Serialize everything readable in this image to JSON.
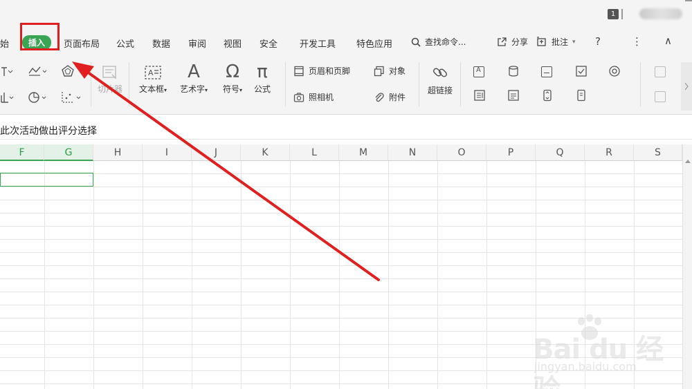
{
  "titlebar": {
    "badge": "1"
  },
  "menu": {
    "tabs": [
      {
        "label": "始",
        "active": false
      },
      {
        "label": "插入",
        "active": true
      },
      {
        "label": "页面布局",
        "active": false
      },
      {
        "label": "公式",
        "active": false
      },
      {
        "label": "数据",
        "active": false
      },
      {
        "label": "审阅",
        "active": false
      },
      {
        "label": "视图",
        "active": false
      },
      {
        "label": "安全",
        "active": false
      },
      {
        "label": "开发工具",
        "active": false
      },
      {
        "label": "特色应用",
        "active": false
      }
    ],
    "search_label": "查找命令...",
    "share_label": "分享",
    "comment_label": "批注",
    "help_glyph": "?",
    "more_glyph": "⋮",
    "collapse_glyph": "∧"
  },
  "ribbon": {
    "slicer_label": "切片器",
    "textbox_label": "文本框",
    "wordart_label": "艺术字",
    "symbol_label": "符号",
    "formula_label": "公式",
    "header_footer_label": "页眉和页脚",
    "camera_label": "照相机",
    "object_label": "对象",
    "attachment_label": "附件",
    "hyperlink_label": "超链接",
    "symbol_glyph": "Ω",
    "formula_glyph": "π",
    "wordart_glyph": "A",
    "dropdown_glyph": "▾"
  },
  "formula_bar": {
    "content": "此次活动做出评分选择"
  },
  "grid": {
    "columns": [
      "F",
      "G",
      "H",
      "I",
      "J",
      "K",
      "L",
      "M",
      "N",
      "O",
      "P",
      "Q",
      "R",
      "S"
    ],
    "selected_columns": [
      "F",
      "G"
    ]
  },
  "watermark": {
    "main": "Bai du 经验",
    "sub": "jingyan.baidu.com"
  },
  "colors": {
    "accent": "#3aa553",
    "highlight": "#e02020"
  }
}
